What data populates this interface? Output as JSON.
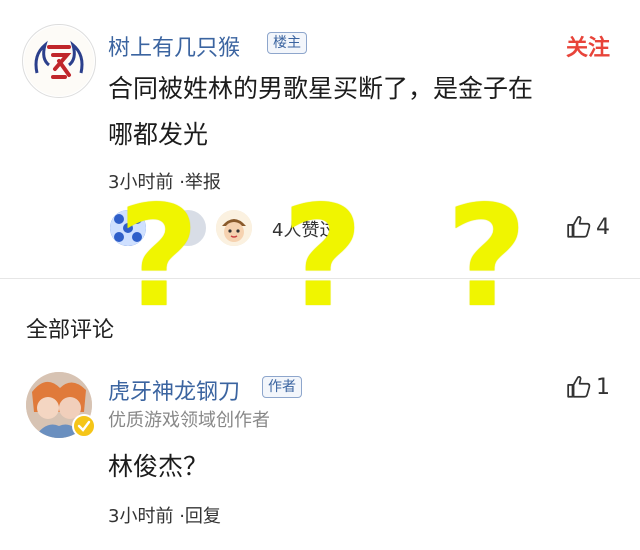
{
  "post": {
    "author": "树上有几只猴",
    "author_tag": "楼主",
    "follow": "关注",
    "content_line1": "合同被姓林的男歌星买断了，是金子在",
    "content_line2": "哪都发光",
    "time": "3小时前",
    "report": "·举报",
    "likers_text": "4人赞过",
    "like_count": "4"
  },
  "overlay": {
    "marks": [
      "?",
      "?",
      "?"
    ]
  },
  "section": {
    "title": "全部评论"
  },
  "comment": {
    "author": "虎牙神龙钢刀",
    "author_tag": "作者",
    "subtitle": "优质游戏领域创作者",
    "content": "林俊杰？",
    "time": "3小时前",
    "reply": "·回复",
    "like_count": "1"
  },
  "icons": {
    "like": "thumbs-up-icon",
    "verified": "verified-badge-icon"
  },
  "colors": {
    "name_blue": "#3b64a0",
    "follow_red": "#e8443a",
    "overlay_yellow": "#f0f500"
  }
}
